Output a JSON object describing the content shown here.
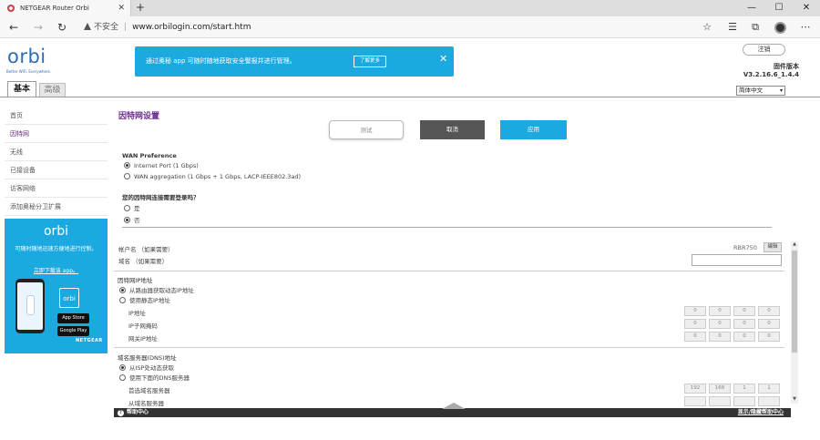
{
  "browser": {
    "tab_title": "NETGEAR Router Orbi",
    "new_tab_label": "+",
    "url_warning": "不安全",
    "url": "www.orbilogin.com/start.htm",
    "window_controls": [
      "—",
      "☐",
      "✕"
    ]
  },
  "header": {
    "logo_text": "orbi",
    "logo_tagline": "Better WiFi. Everywhere.",
    "banner_text": "通过奥秘 app 可随时随地获取安全警报并进行管理。",
    "banner_button": "了解更多",
    "banner_close": "✕",
    "logout_label": "注销",
    "firmware_label": "固件版本",
    "firmware_version": "V3.2.16.6_1.4.4",
    "language_selected": "简体中文"
  },
  "mainnav": {
    "basic": "基本",
    "advanced": "高级"
  },
  "sidebar": {
    "items": [
      {
        "label": "首页"
      },
      {
        "label": "因特网"
      },
      {
        "label": "无线"
      },
      {
        "label": "已接设备"
      },
      {
        "label": "访客网络"
      },
      {
        "label": "添加奥秘分卫扩展"
      }
    ],
    "promo": {
      "logo": "orbi",
      "text": "可随时随地迅速方便地进行控制。",
      "link": "立即下载该 app。",
      "app_logo": "orbi",
      "app_store": "App Store",
      "google_play": "Google Play",
      "brand": "NETGEAR"
    }
  },
  "main": {
    "title": "因特网设置",
    "buttons": {
      "test": "测试",
      "cancel": "取消",
      "apply": "应用"
    },
    "wan_preference": {
      "label": "WAN Preference",
      "options": [
        "Internet Port (1 Gbps)",
        "WAN aggregation (1 Gbps + 1 Gbps, LACP-IEEE802.3ad)"
      ],
      "selected": 0
    },
    "login_question": {
      "label": "您的因特网连接需要登录吗？",
      "options": [
        "是",
        "否"
      ],
      "selected": 1
    },
    "account_name": {
      "label": "帐户名 （如果需要）",
      "value": "RBR750",
      "edit": "编辑"
    },
    "domain_name": {
      "label": "域名 （如果需要）",
      "value": ""
    },
    "internet_ip": {
      "label": "因特网IP地址",
      "options": [
        "从路由器获取动态IP地址",
        "使用静态IP地址"
      ],
      "selected": 0,
      "fields": [
        {
          "label": "IP地址",
          "octets": [
            "0",
            "0",
            "0",
            "0"
          ]
        },
        {
          "label": "IP子网掩码",
          "octets": [
            "0",
            "0",
            "0",
            "0"
          ]
        },
        {
          "label": "网关IP地址",
          "octets": [
            "0",
            "0",
            "0",
            "0"
          ]
        }
      ]
    },
    "dns": {
      "label": "域名服务器(DNS)地址",
      "options": [
        "从ISP处动态获取",
        "使用下面的DNS服务器"
      ],
      "selected": 0,
      "fields": [
        {
          "label": "首选域名服务器",
          "octets": [
            "192",
            "168",
            "1",
            "1"
          ]
        },
        {
          "label": "从域名服务器",
          "octets": [
            "",
            "",
            "",
            ""
          ]
        }
      ]
    }
  },
  "footer": {
    "help_icon": "?",
    "help_label": "帮助中心",
    "toggle_label": "显示/隐藏帮助中心"
  }
}
